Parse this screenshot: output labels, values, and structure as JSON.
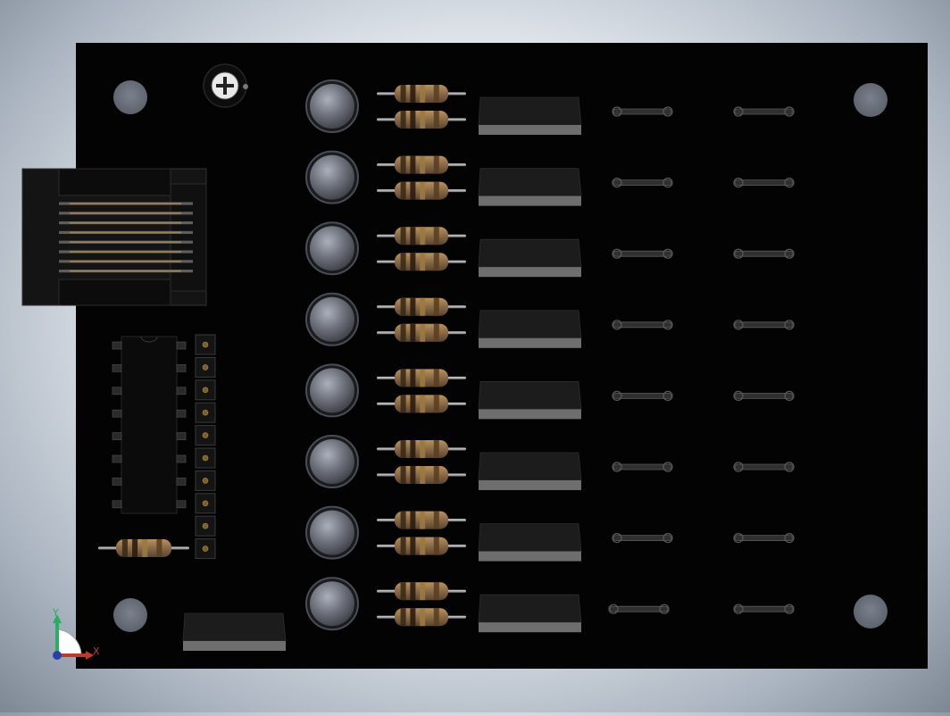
{
  "viewport": {
    "background_color": "#dfe4ea"
  },
  "board": {
    "color": "#030303",
    "mounting_holes": 4,
    "channels": 8,
    "led_color": "#6b6e78",
    "resistor_body_color": "#8a6a45",
    "resistor_band_colors": [
      "#3b2a1a",
      "#2a1c10",
      "#9a7a40",
      "#5a3f22"
    ],
    "sip_relay_color": "#1c1c1c",
    "sip_relay_lead_color": "#6e6e6e",
    "jumper_color": "#2f2f2f",
    "dip_pins_per_side": 8,
    "header_pins": 10
  },
  "triad": {
    "x_label": "X",
    "y_label": "Y",
    "x_color": "#c0392b",
    "y_color": "#27ae60",
    "z_color": "#2c3eaa"
  }
}
